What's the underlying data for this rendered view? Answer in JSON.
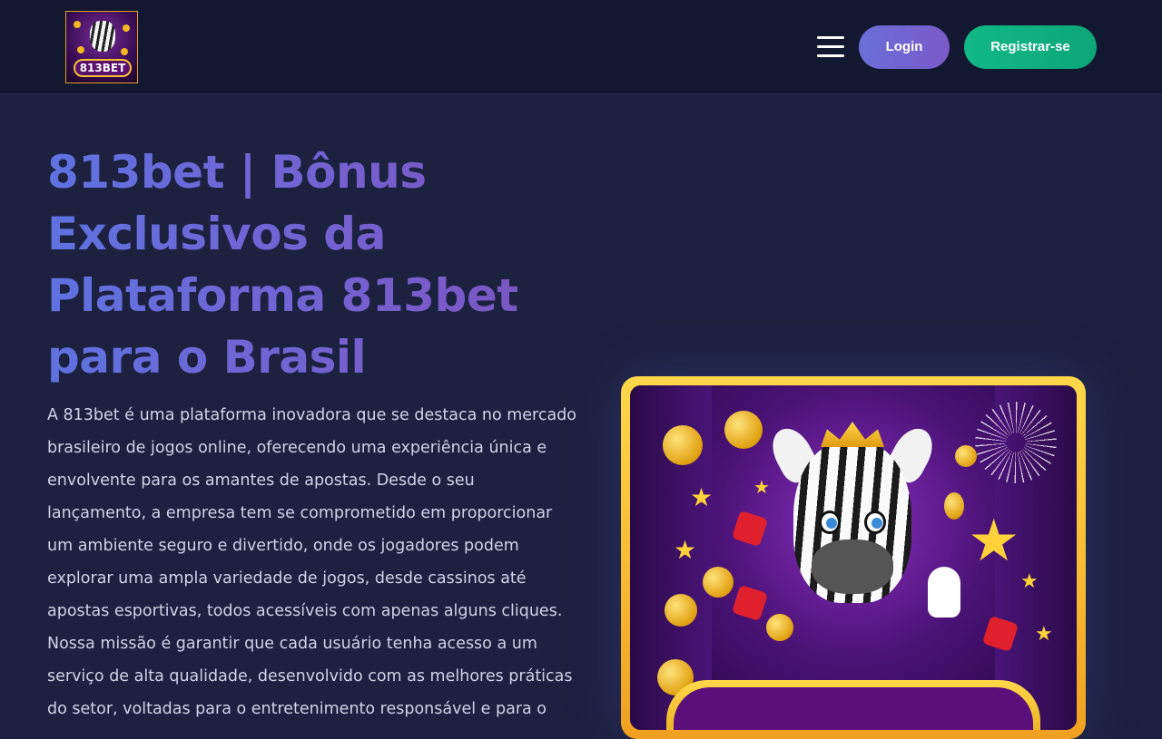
{
  "header": {
    "logo_text": "813BET",
    "menu_icon": "hamburger-menu-icon",
    "login_label": "Login",
    "register_label": "Registrar-se"
  },
  "hero": {
    "title": "813bet | Bônus Exclusivos da Plataforma 813bet para o Brasil",
    "description": "A 813bet é uma plataforma inovadora que se destaca no mercado brasileiro de jogos online, oferecendo uma experiência única e envolvente para os amantes de apostas. Desde o seu lançamento, a empresa tem se comprometido em proporcionar um ambiente seguro e divertido, onde os jogadores podem explorar uma ampla variedade de jogos, desde cassinos até apostas esportivas, todos acessíveis com apenas alguns cliques. Nossa missão é garantir que cada usuário tenha acesso a um serviço de alta qualidade, desenvolvido com as melhores práticas do setor, voltadas para o entretenimento responsável e para o"
  },
  "colors": {
    "header_bg": "#121830",
    "page_bg": "#1c2140",
    "title_gradient_start": "#5f72e0",
    "title_gradient_end": "#7a55c0",
    "login_button": "#6a6fd8",
    "register_button": "#12b886",
    "body_text": "#cfd3e6"
  }
}
